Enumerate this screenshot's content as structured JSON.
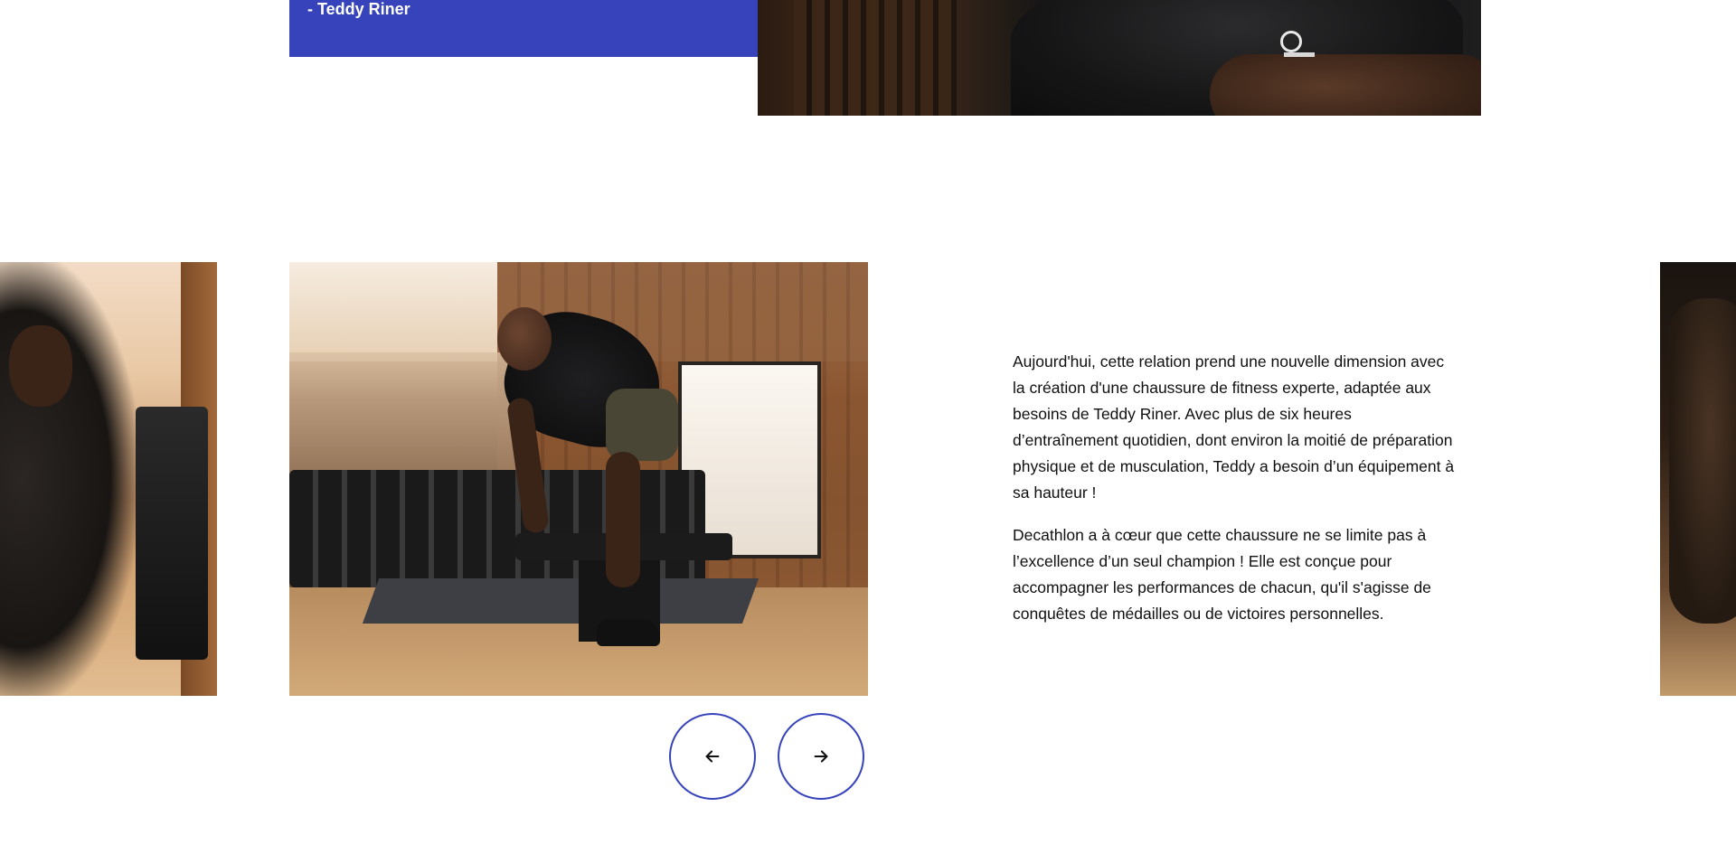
{
  "quote": {
    "author": "- Teddy Riner"
  },
  "content": {
    "paragraph_1": "Aujourd'hui, cette relation prend une nouvelle dimension avec la création d'une chaussure de fitness experte, adaptée aux besoins de Teddy Riner. Avec plus de six heures d’entraînement quotidien, dont environ la moitié de préparation physique et de musculation, Teddy a besoin d’un équipement à sa hauteur !",
    "paragraph_2": "Decathlon a à cœur que cette chaussure ne se limite pas à l’excellence d’un seul champion ! Elle est conçue pour accompagner les performances de chacun, qu'il s'agisse de conquêtes de médailles ou de victoires personnelles."
  },
  "carousel": {
    "prev_icon": "arrow-left-icon",
    "next_icon": "arrow-right-icon"
  },
  "colors": {
    "brand_blue": "#3643ba",
    "text": "#101010",
    "background": "#ffffff"
  }
}
